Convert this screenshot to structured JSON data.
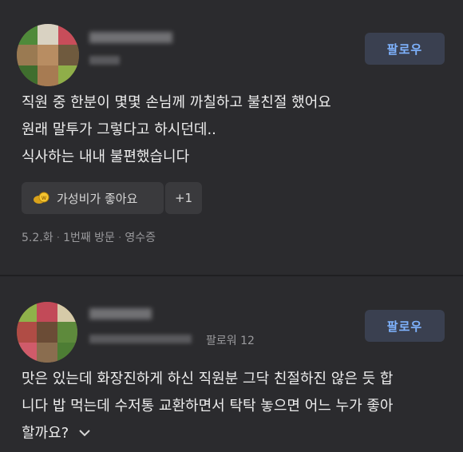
{
  "review1": {
    "follow_label": "팔로우",
    "text_lines": [
      "직원 중 한분이 몇몇 손님께 까칠하고 불친절 했어요",
      "원래 말투가 그렇다고 하시던데..",
      "식사하는 내내 불편했습니다"
    ],
    "tag_label": "가성비가 좋아요",
    "tag_more": "+1",
    "meta": {
      "date": "5.2.화",
      "visit": "1번째 방문",
      "receipt": "영수증"
    }
  },
  "review2": {
    "follow_label": "팔로우",
    "follower_text": "팔로워 12",
    "text_lines": [
      "맛은 있는데 화장진하게 하신 직원분 그닥 친절하진 않은 듯 합",
      "니다 밥 먹는데 수저통 교환하면서 탁탁 놓으면 어느 누가 좋아",
      "할까요?"
    ],
    "expand_icon": "chevron-down-icon"
  },
  "colors": {
    "background": "#2b2b2e",
    "follow_bg": "#3a4050",
    "follow_text": "#7fb3ff"
  }
}
